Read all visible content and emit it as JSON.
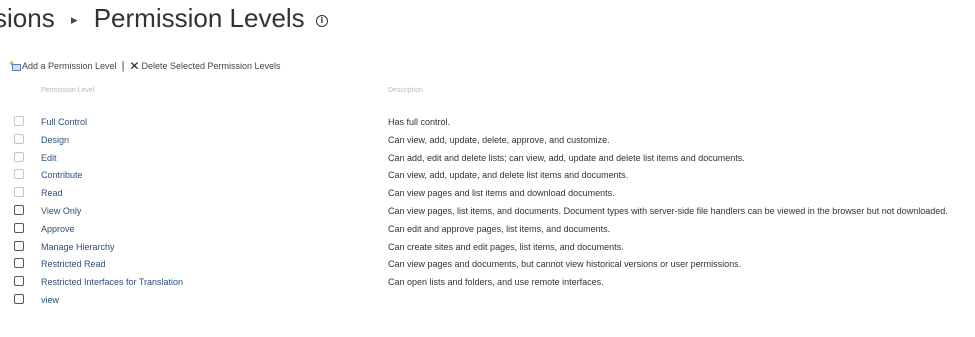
{
  "page": {
    "title_parent": "sions",
    "title_separator": "▸",
    "title_current": "Permission Levels",
    "info_glyph": "i"
  },
  "toolbar": {
    "add_label": "Add a Permission Level",
    "separator": "|",
    "delete_icon_glyph": "✕",
    "delete_label": "Delete Selected Permission Levels"
  },
  "table": {
    "columns": [
      "Permission Level",
      "Description"
    ],
    "rows": [
      {
        "name": "Full Control",
        "description": "Has full control.",
        "checkbox_enabled": false
      },
      {
        "name": "Design",
        "description": "Can view, add, update, delete, approve, and customize.",
        "checkbox_enabled": false
      },
      {
        "name": "Edit",
        "description": "Can add, edit and delete lists; can view, add, update and delete list items and documents.",
        "checkbox_enabled": false
      },
      {
        "name": "Contribute",
        "description": "Can view, add, update, and delete list items and documents.",
        "checkbox_enabled": false
      },
      {
        "name": "Read",
        "description": "Can view pages and list items and download documents.",
        "checkbox_enabled": false
      },
      {
        "name": "View Only",
        "description": "Can view pages, list items, and documents. Document types with server-side file handlers can be viewed in the browser but not downloaded.",
        "checkbox_enabled": true
      },
      {
        "name": "Approve",
        "description": "Can edit and approve pages, list items, and documents.",
        "checkbox_enabled": true
      },
      {
        "name": "Manage Hierarchy",
        "description": "Can create sites and edit pages, list items, and documents.",
        "checkbox_enabled": true
      },
      {
        "name": "Restricted Read",
        "description": "Can view pages and documents, but cannot view historical versions or user permissions.",
        "checkbox_enabled": true
      },
      {
        "name": "Restricted Interfaces for Translation",
        "description": "Can open lists and folders, and use remote interfaces.",
        "checkbox_enabled": true
      },
      {
        "name": "view",
        "description": "",
        "checkbox_enabled": true
      }
    ]
  },
  "colors": {
    "link": "#2c4f7c",
    "header_text": "#b9b9b9",
    "disabled_checkbox": "#c6c6c6"
  }
}
